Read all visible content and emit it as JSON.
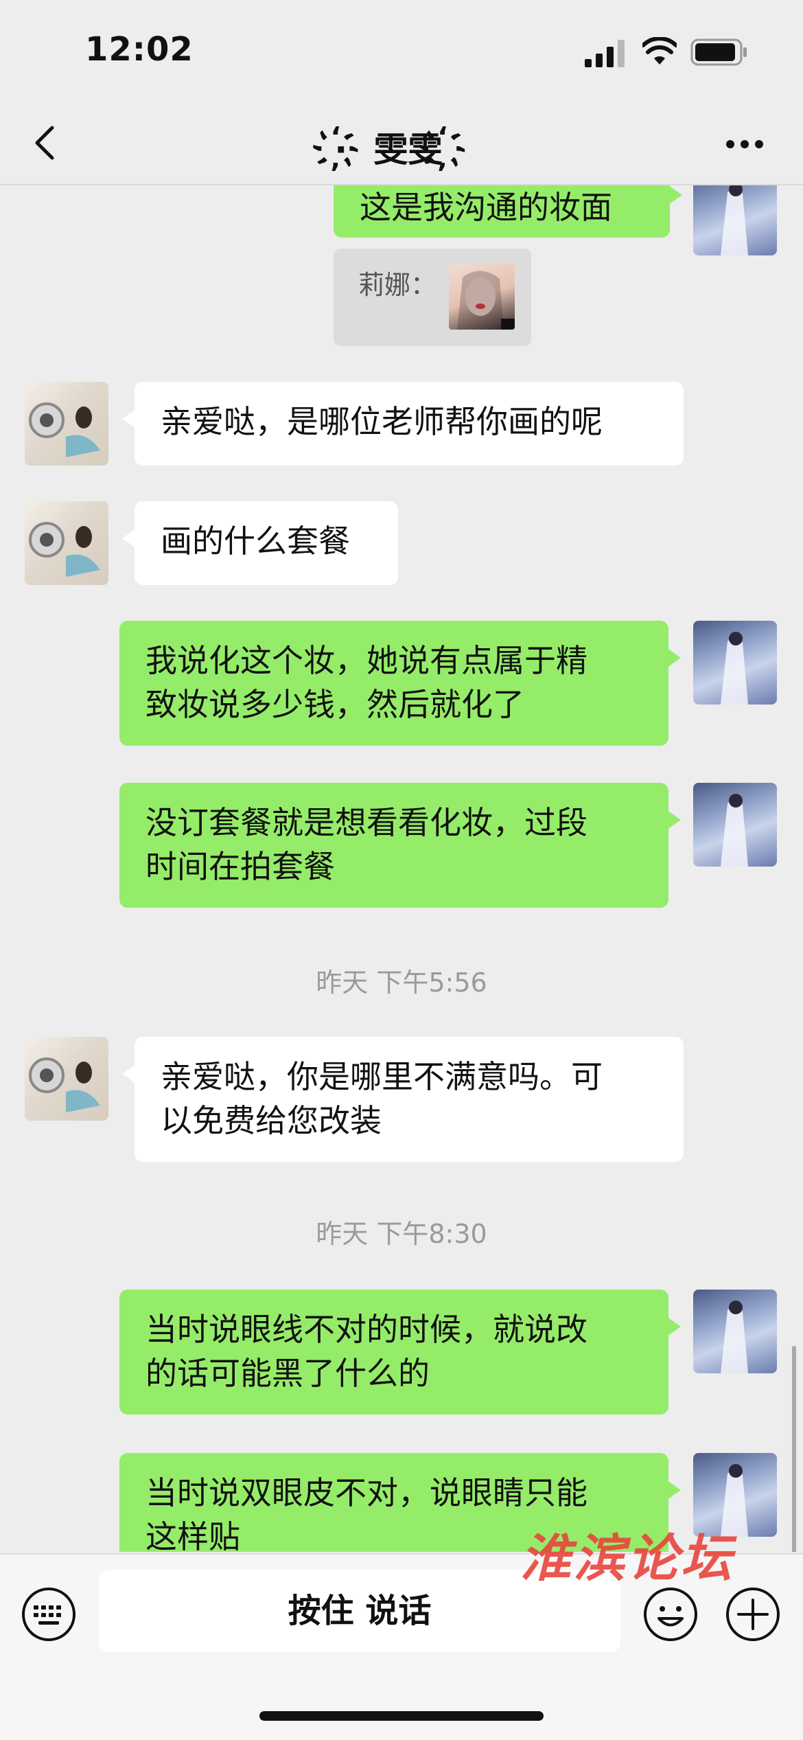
{
  "status_bar": {
    "time": "12:02"
  },
  "nav": {
    "title": "·҉ 雯雯 ҉",
    "back_icon": "chevron-left-icon",
    "more_icon": "ellipsis-icon"
  },
  "colors": {
    "my_bubble": "#95ec69",
    "other_bubble": "#ffffff",
    "background": "#ededed"
  },
  "messages": [
    {
      "sender": "me",
      "text": "这是我沟通的妆面"
    },
    {
      "sender": "me",
      "quote_label": "莉娜：",
      "type": "quote-image"
    },
    {
      "sender": "other",
      "text": "亲爱哒，是哪位老师帮你画的呢"
    },
    {
      "sender": "other",
      "text": "画的什么套餐"
    },
    {
      "sender": "me",
      "line1": "我说化这个妆，她说有点属于精",
      "line2": "致妆说多少钱，然后就化了"
    },
    {
      "sender": "me",
      "line1": "没订套餐就是想看看化妆，过段",
      "line2": "时间在拍套餐"
    },
    {
      "type": "timestamp",
      "text": "昨天 下午5:56"
    },
    {
      "sender": "other",
      "line1": "亲爱哒，你是哪里不满意吗。可",
      "line2": "以免费给您改装"
    },
    {
      "type": "timestamp",
      "text": "昨天 下午8:30"
    },
    {
      "sender": "me",
      "line1": "当时说眼线不对的时候，就说改",
      "line2": "的话可能黑了什么的"
    },
    {
      "sender": "me",
      "line1": "当时说双眼皮不对，说眼睛只能",
      "line2": "这样贴"
    }
  ],
  "input_bar": {
    "voice_label": "按住 说话"
  },
  "watermark": "淮滨论坛"
}
